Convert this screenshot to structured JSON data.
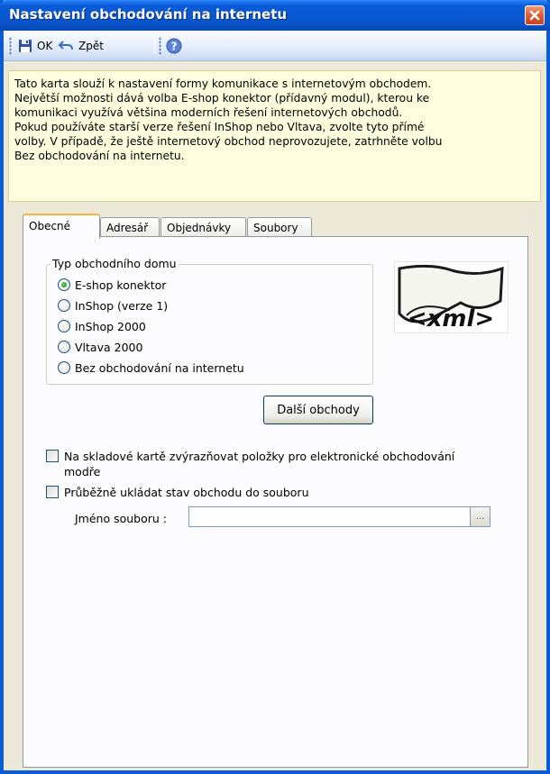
{
  "window": {
    "title": "Nastavení obchodování na internetu"
  },
  "toolbar": {
    "ok_label": "OK",
    "back_label": "Zpět"
  },
  "info": {
    "lines": [
      "Tato karta slouží k nastavení formy komunikace s internetovým obchodem.",
      "Největší možnosti dává volba E-shop konektor (přídavný modul), kterou ke",
      "komunikaci využívá většina moderních řešení internetových obchodů.",
      "Pokud používáte starší verze řešení InShop nebo Vltava, zvolte tyto přímé",
      "volby. V případě, že ještě internetový obchod neprovozujete, zatrhněte volbu",
      "Bez obchodování na internetu."
    ]
  },
  "tabs": [
    {
      "label": "Obecné",
      "active": true
    },
    {
      "label": "Adresář"
    },
    {
      "label": "Objednávky"
    },
    {
      "label": "Soubory"
    }
  ],
  "shop_type": {
    "legend": "Typ obchodního domu",
    "options": [
      {
        "label": "E-shop konektor",
        "checked": true
      },
      {
        "label": "InShop (verze 1)"
      },
      {
        "label": "InShop 2000"
      },
      {
        "label": "Vltava 2000"
      },
      {
        "label": "Bez obchodování na internetu"
      }
    ]
  },
  "logo": {
    "text": "<xml>"
  },
  "more_shops_button": "Další obchody",
  "options": {
    "highlight_line1": "Na skladové kartě zvýrazňovat položky pro elektronické obchodování",
    "highlight_line2": "modře",
    "save_state": "Průběžně ukládat stav obchodu do souboru"
  },
  "file": {
    "label": "Jméno souboru :",
    "value": "",
    "browse": "..."
  },
  "colors": {
    "title_bar": "#0a5bd5",
    "info_bg": "#ffffdf",
    "active_tab_accent": "#f5b43f"
  },
  "icons": {
    "ok": "save-disk-icon",
    "back": "undo-icon",
    "help": "help-icon",
    "close": "close-icon"
  }
}
